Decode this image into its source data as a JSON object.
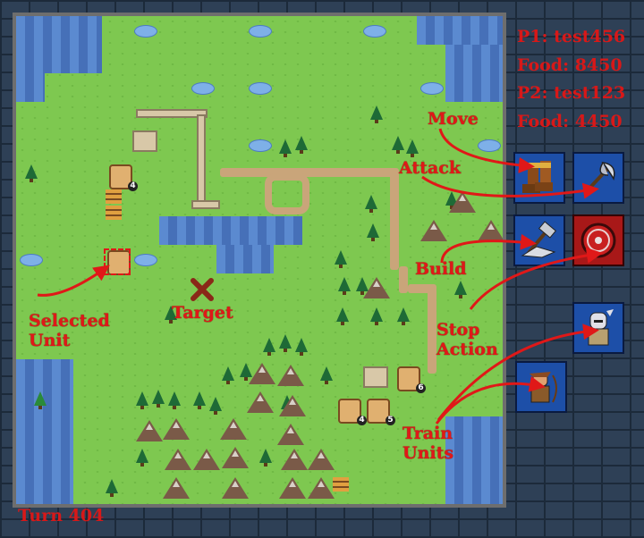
{
  "hud": {
    "p1": "P1: test456",
    "p1_food": "Food: 8450",
    "p2": "P2: test123",
    "p2_food": "Food: 4450",
    "turn": "Turn 404"
  },
  "annotations": {
    "move": "Move",
    "attack": "Attack",
    "build": "Build",
    "stop_action": "Stop Action",
    "selected_unit": "Selected Unit",
    "target": "Target",
    "train_units": "Train Units"
  },
  "actions": [
    {
      "name": "move",
      "icon": "boots-icon"
    },
    {
      "name": "attack",
      "icon": "axe-icon"
    },
    {
      "name": "build",
      "icon": "hammer-icon"
    },
    {
      "name": "stop",
      "icon": "shield-icon"
    }
  ],
  "train": [
    {
      "name": "knight",
      "icon": "knight-icon"
    },
    {
      "name": "archer",
      "icon": "archer-icon"
    }
  ],
  "units": [
    {
      "level": "4"
    },
    {
      "level": "6"
    },
    {
      "level": "4"
    },
    {
      "level": "5"
    }
  ],
  "colors": {
    "annotation": "#e01818",
    "grass": "#7ec850",
    "water": "#4c7bc4",
    "button": "#1d4fa8"
  }
}
